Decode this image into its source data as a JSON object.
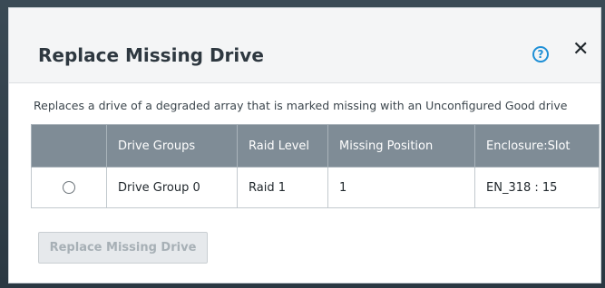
{
  "dialog": {
    "title": "Replace Missing Drive",
    "help_icon": "help-icon",
    "help_glyph": "?",
    "close_icon": "close-icon",
    "close_glyph": "✕",
    "description": "Replaces a drive of a degraded array that is marked missing with an Unconfigured Good drive"
  },
  "table": {
    "columns": [
      "",
      "Drive Groups",
      "Raid Level",
      "Missing Position",
      "Enclosure:Slot"
    ],
    "rows": [
      {
        "selected": false,
        "drive_group": "Drive Group 0",
        "raid_level": "Raid 1",
        "missing_position": "1",
        "enclosure_slot": "EN_318 : 15"
      }
    ]
  },
  "actions": {
    "replace_label": "Replace Missing Drive",
    "replace_disabled": true
  },
  "colors": {
    "header_bg": "#7f8c96",
    "accent": "#1e8fd6",
    "disabled_text": "#a7b0b6"
  }
}
